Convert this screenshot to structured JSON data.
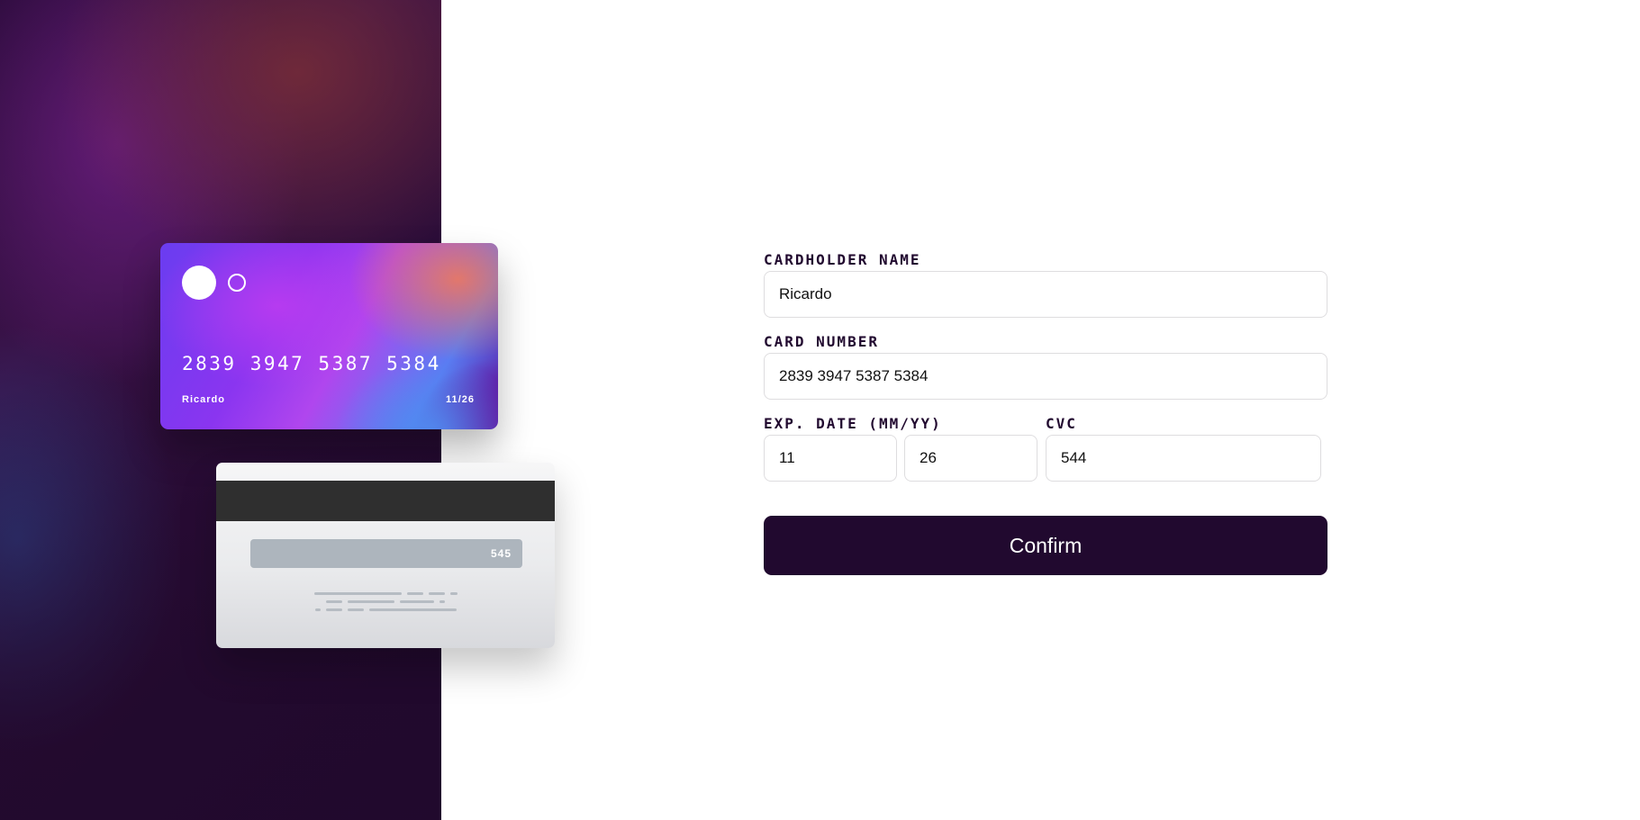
{
  "card_front": {
    "number": "2839 3947 5387 5384",
    "holder": "Ricardo",
    "exp_month": "11",
    "exp_separator": "/",
    "exp_year": "26"
  },
  "card_back": {
    "cvc": "545"
  },
  "form": {
    "name_label": "CARDHOLDER NAME",
    "name_value": "Ricardo",
    "number_label": "CARD NUMBER",
    "number_value": "2839 3947 5387 5384",
    "exp_label": "EXP. DATE (MM/YY)",
    "exp_month_value": "11",
    "exp_year_value": "26",
    "cvc_label": "CVC",
    "cvc_value": "544",
    "confirm_label": "Confirm"
  },
  "colors": {
    "dark_violet": "#21092f",
    "input_border": "#dedddf"
  }
}
